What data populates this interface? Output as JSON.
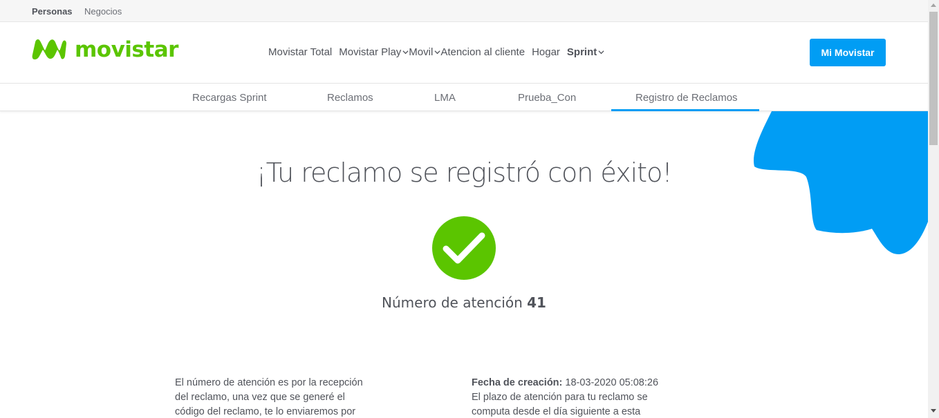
{
  "topbar": {
    "personas": "Personas",
    "negocios": "Negocios"
  },
  "brand": {
    "name": "movistar",
    "color": "#5bc500",
    "accent": "#019df4"
  },
  "nav": {
    "items": [
      {
        "label": "Movistar Total",
        "dropdown": false
      },
      {
        "label": "Movistar Play",
        "dropdown": true
      },
      {
        "label": "Movil",
        "dropdown": true
      },
      {
        "label": "Atencion al cliente",
        "dropdown": false
      },
      {
        "label": "Hogar",
        "dropdown": false
      },
      {
        "label": "Sprint",
        "dropdown": true
      }
    ],
    "cta": "Mi Movistar"
  },
  "subnav": {
    "tabs": [
      "Recargas Sprint",
      "Reclamos",
      "LMA",
      "Prueba_Con",
      "Registro de Reclamos"
    ],
    "active": "Registro de Reclamos"
  },
  "main": {
    "title": "¡Tu reclamo se registró con éxito!",
    "attention_label": "Número de atención",
    "attention_number": "41",
    "left_text": "El número de atención es por la recepción del reclamo, una vez que se generé el código del reclamo, te lo enviaremos por",
    "creation_label": "Fecha de creación:",
    "creation_value": "18-03-2020 05:08:26",
    "right_text": "El plazo de atención para tu reclamo se computa desde el día siguiente a esta"
  },
  "icons": {
    "success": "check-circle-icon",
    "dropdown": "chevron-down-icon"
  }
}
